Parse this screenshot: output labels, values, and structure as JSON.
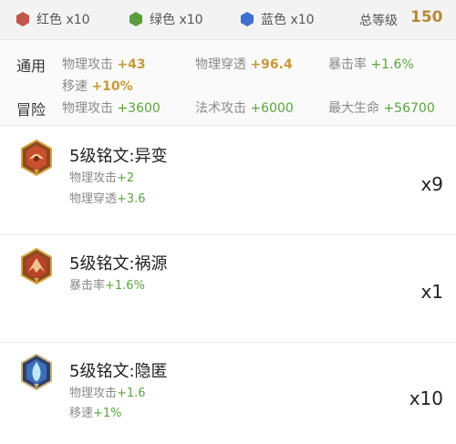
{
  "gems": [
    {
      "icon": "red-hexagon-icon",
      "label": "红色 x10",
      "color": "#c0574c"
    },
    {
      "icon": "green-hexagon-icon",
      "label": "绿色 x10",
      "color": "#5a9e3c"
    },
    {
      "icon": "blue-hexagon-icon",
      "label": "蓝色 x10",
      "color": "#3f6fd0"
    }
  ],
  "level": {
    "label": "总等级",
    "value": "150"
  },
  "stats": {
    "general": {
      "title": "通用",
      "items": [
        {
          "name": "物理攻击",
          "bonus": "+43"
        },
        {
          "name": "物理穿透",
          "bonus": "+96.4"
        },
        {
          "name": "暴击率",
          "bonus": "+1.6%"
        },
        {
          "name": "移速",
          "bonus": "+10%"
        }
      ]
    },
    "adventure": {
      "title": "冒险",
      "items": [
        {
          "name": "物理攻击",
          "bonus": "+3600"
        },
        {
          "name": "法术攻击",
          "bonus": "+6000"
        },
        {
          "name": "最大生命",
          "bonus": "+56700"
        }
      ]
    }
  },
  "runes": [
    {
      "icon": "red-rune-icon",
      "title": "5级铭文:异变",
      "attrs": [
        {
          "name": "物理攻击",
          "bonus": "+2"
        },
        {
          "name": "物理穿透",
          "bonus": "+3.6"
        }
      ],
      "count": "x9"
    },
    {
      "icon": "red-rune-icon",
      "title": "5级铭文:祸源",
      "attrs": [
        {
          "name": "暴击率",
          "bonus": "+1.6%"
        }
      ],
      "count": "x1"
    },
    {
      "icon": "blue-rune-icon",
      "title": "5级铭文:隐匿",
      "attrs": [
        {
          "name": "物理攻击",
          "bonus": "+1.6"
        },
        {
          "name": "移速",
          "bonus": "+1%"
        }
      ],
      "count": "x10"
    }
  ]
}
